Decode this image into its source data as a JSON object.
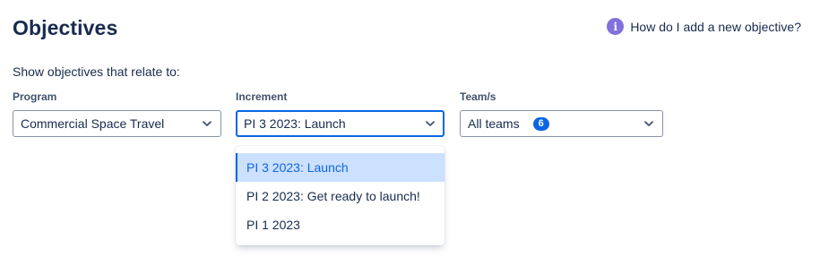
{
  "header": {
    "title": "Objectives",
    "help_link": "How do I add a new objective?",
    "help_icon": "info-icon"
  },
  "filters": {
    "intro": "Show objectives that relate to:",
    "program": {
      "label": "Program",
      "value": "Commercial Space Travel"
    },
    "increment": {
      "label": "Increment",
      "value": "PI 3 2023: Launch",
      "options": [
        "PI 3 2023: Launch",
        "PI 2 2023: Get ready to launch!",
        "PI 1 2023"
      ],
      "selected_index": 0
    },
    "teams": {
      "label": "Team/s",
      "value": "All teams",
      "count": "6"
    }
  },
  "colors": {
    "accent": "#0c66e4",
    "help_icon": "#8270db",
    "selected_option_bg": "#cce0ff",
    "text": "#172b4d"
  }
}
